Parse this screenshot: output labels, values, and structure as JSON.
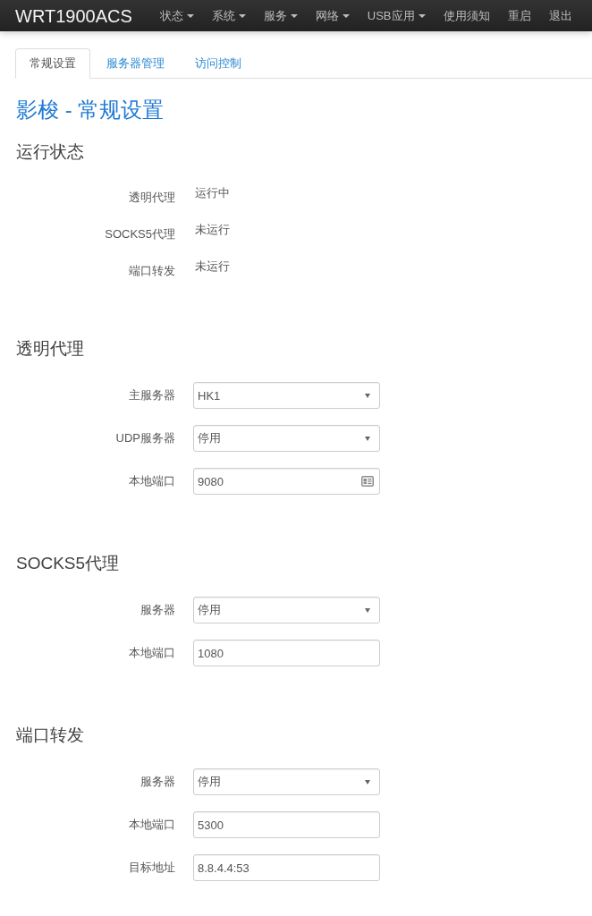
{
  "navbar": {
    "brand": "WRT1900ACS",
    "menu": [
      {
        "label": "状态",
        "dropdown": true
      },
      {
        "label": "系统",
        "dropdown": true
      },
      {
        "label": "服务",
        "dropdown": true
      },
      {
        "label": "网络",
        "dropdown": true
      },
      {
        "label": "USB应用",
        "dropdown": true
      },
      {
        "label": "使用须知",
        "dropdown": false
      },
      {
        "label": "重启",
        "dropdown": false
      },
      {
        "label": "退出",
        "dropdown": false
      }
    ]
  },
  "tabs": [
    {
      "label": "常规设置",
      "selected": true
    },
    {
      "label": "服务器管理",
      "selected": false
    },
    {
      "label": "访问控制",
      "selected": false
    }
  ],
  "title": "影梭 - 常规设置",
  "status_section": {
    "heading": "运行状态",
    "rows": [
      {
        "label": "透明代理",
        "value": "运行中"
      },
      {
        "label": "SOCKS5代理",
        "value": "未运行"
      },
      {
        "label": "端口转发",
        "value": "未运行"
      }
    ]
  },
  "sections": [
    {
      "heading": "透明代理",
      "fields": [
        {
          "label": "主服务器",
          "kind": "select",
          "value": "HK1"
        },
        {
          "label": "UDP服务器",
          "kind": "select",
          "value": "停用"
        },
        {
          "label": "本地端口",
          "kind": "cardinput",
          "value": "9080"
        }
      ]
    },
    {
      "heading": "SOCKS5代理",
      "fields": [
        {
          "label": "服务器",
          "kind": "select",
          "value": "停用"
        },
        {
          "label": "本地端口",
          "kind": "input",
          "value": "1080"
        }
      ]
    },
    {
      "heading": "端口转发",
      "fields": [
        {
          "label": "服务器",
          "kind": "select",
          "value": "停用"
        },
        {
          "label": "本地端口",
          "kind": "input",
          "value": "5300"
        },
        {
          "label": "目标地址",
          "kind": "input",
          "value": "8.8.4.4:53"
        }
      ]
    }
  ]
}
